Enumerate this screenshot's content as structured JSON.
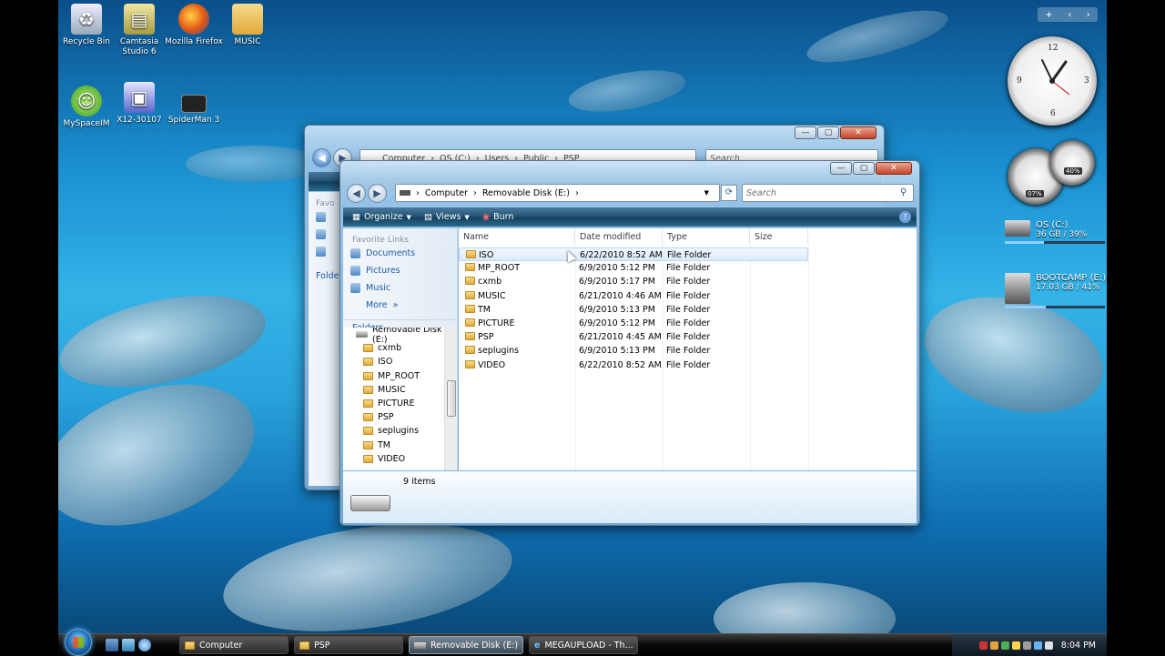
{
  "desktop": {
    "icons": [
      {
        "label": "Recycle Bin",
        "icon": "recycle-bin-icon"
      },
      {
        "label": "Camtasia Studio 6",
        "icon": "camtasia-icon"
      },
      {
        "label": "Mozilla Firefox",
        "icon": "firefox-icon"
      },
      {
        "label": "MUSIC",
        "icon": "folder-icon"
      },
      {
        "label": "MySpaceIM",
        "icon": "myspaceim-icon"
      },
      {
        "label": "X12-30107",
        "icon": "installer-icon"
      },
      {
        "label": "SpiderMan 3",
        "icon": "video-file-icon"
      }
    ]
  },
  "gadgets": {
    "drives": [
      {
        "name": "OS (C:)",
        "info": "36 GB / 39%",
        "used_pct": 39
      },
      {
        "name": "BOOTCAMP (E:)",
        "info": "17.03 GB / 41%",
        "used_pct": 41
      }
    ],
    "gauge_cpu": "07%",
    "gauge_mem": "40%"
  },
  "back_window": {
    "path": [
      "Computer",
      "OS (C:)",
      "Users",
      "Public",
      "PSP"
    ],
    "search_placeholder": "Search",
    "partial_labels": [
      "Favo",
      "Folde"
    ]
  },
  "front_window": {
    "path": [
      "Computer",
      "Removable Disk (E:)"
    ],
    "search_placeholder": "Search",
    "toolbar": {
      "organize": "Organize",
      "views": "Views",
      "burn": "Burn"
    },
    "favorites_title": "Favorite Links",
    "favorites": [
      "Documents",
      "Pictures",
      "Music"
    ],
    "more_label": "More",
    "folders_label": "Folders",
    "tree": [
      "Removable Disk (E:)",
      "cxmb",
      "ISO",
      "MP_ROOT",
      "MUSIC",
      "PICTURE",
      "PSP",
      "seplugins",
      "TM",
      "VIDEO"
    ],
    "columns": [
      "Name",
      "Date modified",
      "Type",
      "Size"
    ],
    "files": [
      {
        "name": "ISO",
        "date": "6/22/2010 8:52 AM",
        "type": "File Folder"
      },
      {
        "name": "MP_ROOT",
        "date": "6/9/2010 5:12 PM",
        "type": "File Folder"
      },
      {
        "name": "cxmb",
        "date": "6/9/2010 5:17 PM",
        "type": "File Folder"
      },
      {
        "name": "MUSIC",
        "date": "6/21/2010 4:46 AM",
        "type": "File Folder"
      },
      {
        "name": "TM",
        "date": "6/9/2010 5:13 PM",
        "type": "File Folder"
      },
      {
        "name": "PICTURE",
        "date": "6/9/2010 5:12 PM",
        "type": "File Folder"
      },
      {
        "name": "PSP",
        "date": "6/21/2010 4:45 AM",
        "type": "File Folder"
      },
      {
        "name": "seplugins",
        "date": "6/9/2010 5:13 PM",
        "type": "File Folder"
      },
      {
        "name": "VIDEO",
        "date": "6/22/2010 8:52 AM",
        "type": "File Folder"
      }
    ],
    "status": "9 items"
  },
  "taskbar": {
    "tasks": [
      "Computer",
      "PSP",
      "Removable Disk (E:)",
      "MEGAUPLOAD - Th..."
    ],
    "clock": "8:04 PM"
  }
}
